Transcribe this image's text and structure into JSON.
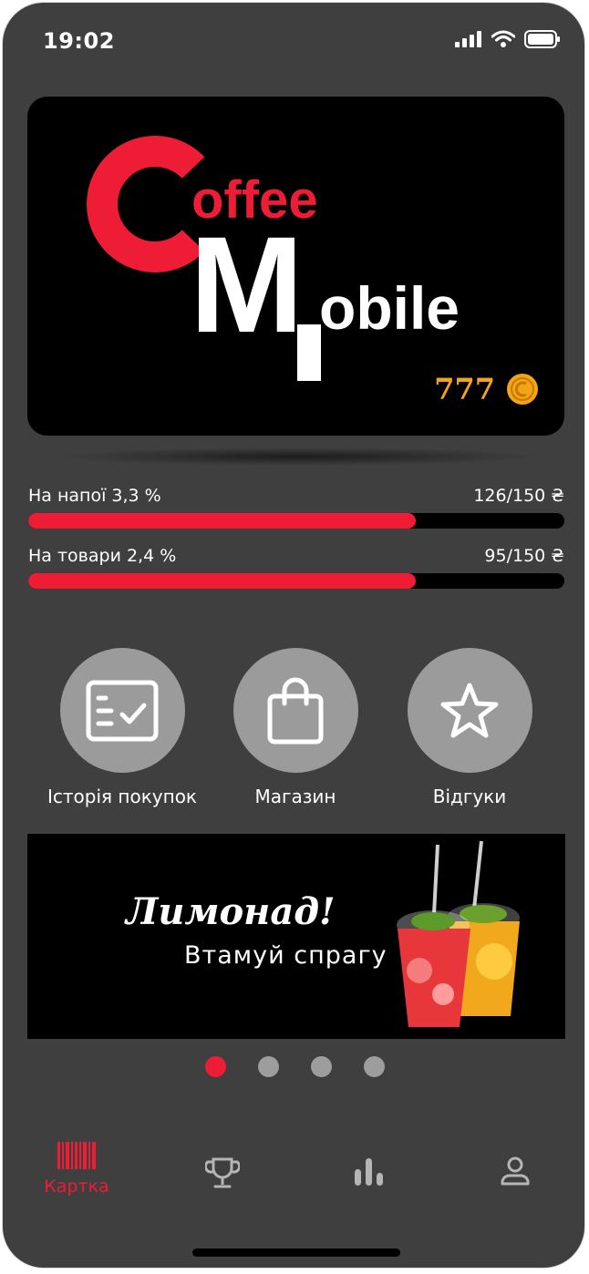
{
  "status_bar": {
    "time": "19:02"
  },
  "card": {
    "logo_word_1": "offee",
    "logo_word_2": "obile",
    "logo_letter_c": "C",
    "logo_letter_m": "M",
    "coins": "777",
    "brand_red": "#ef1c35",
    "coin_color": "#f5a416"
  },
  "progress": [
    {
      "label": "На напої 3,3 %",
      "amount": "126/150 ₴",
      "fraction": 0.723
    },
    {
      "label": "На товари 2,4 %",
      "amount": "95/150 ₴",
      "fraction": 0.722
    }
  ],
  "actions": [
    {
      "label": "Історія покупок",
      "icon": "checklist-icon"
    },
    {
      "label": "Магазин",
      "icon": "shopping-bag-icon"
    },
    {
      "label": "Відгуки",
      "icon": "star-icon"
    }
  ],
  "promo": {
    "title": "Лимонад!",
    "subtitle": "Втамуй спрагу"
  },
  "carousel": {
    "pages": 4,
    "active": 1
  },
  "tabbar": {
    "tabs": [
      {
        "label": "Картка",
        "icon": "barcode-icon",
        "active": true
      },
      {
        "label": "",
        "icon": "trophy-icon",
        "active": false
      },
      {
        "label": "",
        "icon": "bar-chart-icon",
        "active": false
      },
      {
        "label": "",
        "icon": "user-icon",
        "active": false
      }
    ]
  }
}
